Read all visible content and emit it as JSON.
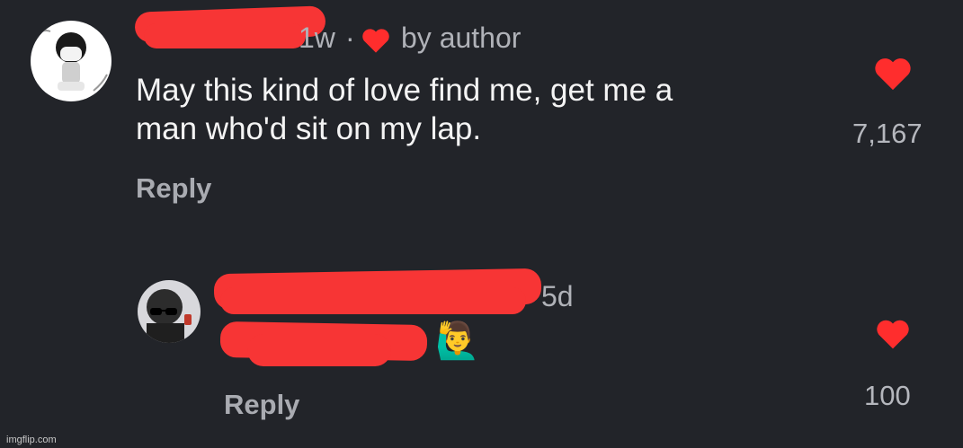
{
  "comments": [
    {
      "age": "1w",
      "separator": "·",
      "author_badge": "by author",
      "text_line1": "May this kind of love find me, get me a",
      "text_line2": "man who'd sit on my lap.",
      "reply_label": "Reply",
      "like_count": "7,167",
      "like_color": "#ff2d2d"
    },
    {
      "age": "5d",
      "emoji": "🙋‍♂️",
      "reply_label": "Reply",
      "like_count": "100",
      "like_color": "#ff2d2d"
    }
  ],
  "watermark": "imgflip.com"
}
